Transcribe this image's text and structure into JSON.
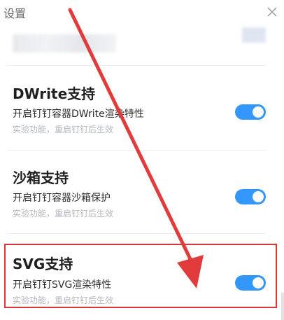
{
  "window": {
    "title": "设置"
  },
  "icons": {
    "close": "close-icon"
  },
  "colors": {
    "toggle_on": "#3296fa",
    "highlight": "#d9383a",
    "arrow": "#e23b3b"
  },
  "sections": [
    {
      "title": "DWrite支持",
      "description": "开启钉钉容器DWrite渲染特性",
      "hint": "实验功能，重启钉钉后生效",
      "enabled": true
    },
    {
      "title": "沙箱支持",
      "description": "开启钉钉容器沙箱保护",
      "hint": "实验功能，重启钉钉后生效",
      "enabled": true
    },
    {
      "title": "SVG支持",
      "description": "开启钉钉SVG渲染特性",
      "hint": "实验功能，重启钉钉后生效",
      "enabled": true
    }
  ]
}
